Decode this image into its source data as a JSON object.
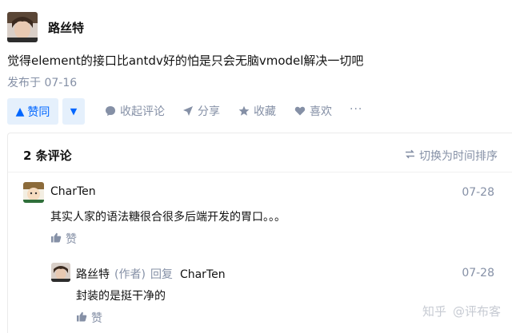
{
  "answer": {
    "author": "路丝特",
    "content": "觉得element的接口比antdv好的怕是只会无脑vmodel解决一切吧",
    "publish_time": "发布于 07-16"
  },
  "actions": {
    "vote_up": "赞同",
    "comment": "收起评论",
    "share": "分享",
    "favorite": "收藏",
    "like": "喜欢",
    "more": "···"
  },
  "comments_panel": {
    "count_label": "2 条评论",
    "sort_label": "切换为时间排序",
    "comments": [
      {
        "author": "CharTen",
        "time": "07-28",
        "content": "其实人家的语法糖很合很多后端开发的胃口。。。",
        "like_label": "赞"
      }
    ],
    "reply": {
      "author": "路丝特",
      "role": "(作者)",
      "reply_word": "回复",
      "reply_to": "CharTen",
      "time": "07-28",
      "content": "封装的是挺干净的",
      "like_label": "赞"
    }
  },
  "watermark": {
    "brand": "知乎",
    "handle": "@评布客"
  },
  "colors": {
    "accent": "#0066ff",
    "accent_bg": "#e5f0fc",
    "muted": "#8590a6"
  }
}
